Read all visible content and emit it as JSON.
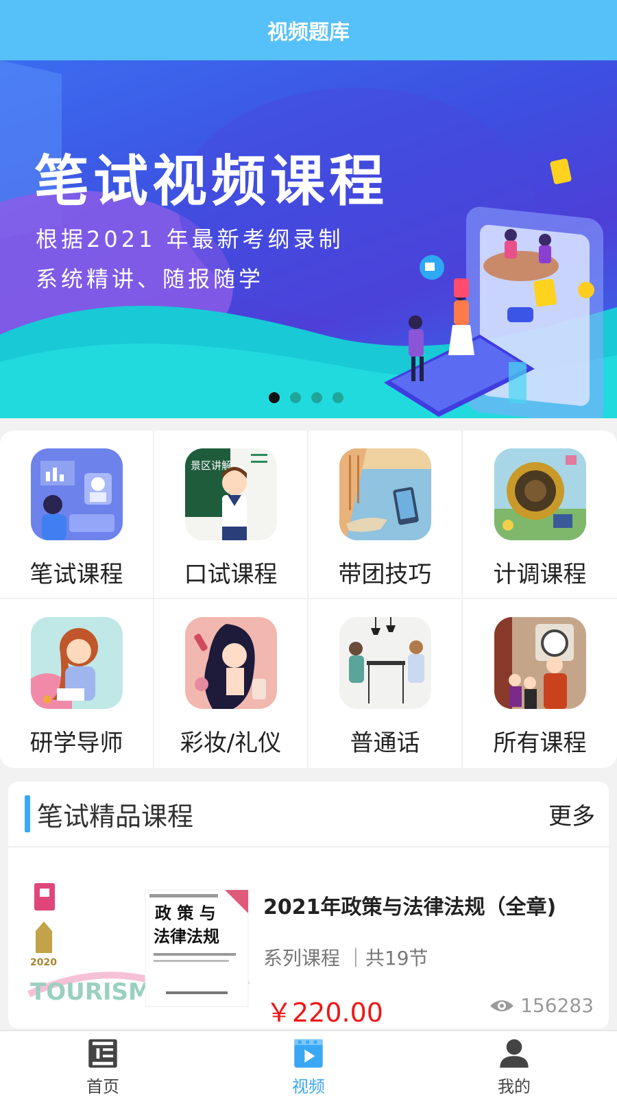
{
  "header": {
    "title": "视频题库"
  },
  "banner": {
    "title": "笔试视频课程",
    "subtitle_line1": "根据2021 年最新考纲录制",
    "subtitle_line2": "系统精讲、随报随学",
    "slide_count": 4,
    "active_slide": 1
  },
  "categories": [
    {
      "label": "笔试课程",
      "icon": "study-robot-illustration"
    },
    {
      "label": "口试课程",
      "icon": "guide-teacher-illustration",
      "thumb_text": "景区讲解"
    },
    {
      "label": "带团技巧",
      "icon": "boat-river-illustration"
    },
    {
      "label": "计调课程",
      "icon": "clock-landscape-illustration"
    },
    {
      "label": "研学导师",
      "icon": "reading-girl-illustration"
    },
    {
      "label": "彩妆/礼仪",
      "icon": "makeup-girl-illustration"
    },
    {
      "label": "普通话",
      "icon": "cafe-chat-illustration"
    },
    {
      "label": "所有课程",
      "icon": "opera-figures-illustration"
    }
  ],
  "section": {
    "title": "笔试精品课程",
    "more_label": "更多"
  },
  "courses": [
    {
      "title": "2021年政策与法律法规（全章)",
      "meta": "系列课程 ｜共19节",
      "price": "￥220.00",
      "views": "156283",
      "cover_title_line1": "政 策 与",
      "cover_title_line2": "法律法规",
      "cover_brand": "TOURISM",
      "cover_year": "2020"
    }
  ],
  "tabbar": {
    "items": [
      {
        "label": "首页",
        "icon": "film-strip-icon"
      },
      {
        "label": "视频",
        "icon": "play-video-icon",
        "active": true
      },
      {
        "label": "我的",
        "icon": "user-icon"
      }
    ]
  },
  "colors": {
    "header": "#56c0f8",
    "accent": "#39a8f5",
    "price": "#f01515"
  }
}
